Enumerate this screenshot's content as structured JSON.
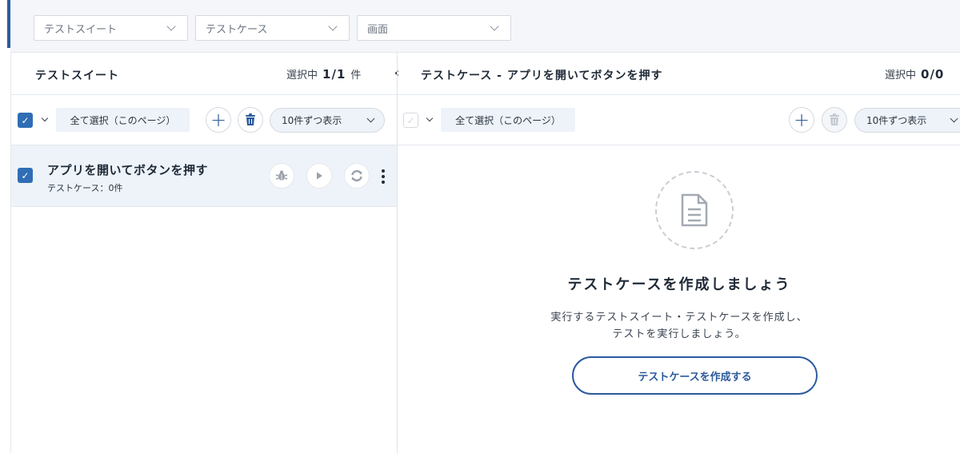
{
  "filters": [
    {
      "placeholder": "テストスイート"
    },
    {
      "placeholder": "テストケース"
    },
    {
      "placeholder": "画面"
    }
  ],
  "left_panel": {
    "title": "テストスイート",
    "selected_label": "選択中",
    "selected_value": "1/1",
    "selected_unit": "件",
    "select_all_label": "全て選択（このページ）",
    "page_size_label": "10件ずつ表示",
    "header_checkbox_checked": true,
    "suites": [
      {
        "name": "アプリを開いてボタンを押す",
        "subtitle": "テストケース：0件",
        "checked": true
      }
    ]
  },
  "right_panel": {
    "title": "テストケース - アプリを開いてボタンを押す",
    "selected_label": "選択中",
    "selected_value": "0/0",
    "select_all_label": "全て選択（このページ）",
    "page_size_label": "10件ずつ表示",
    "header_checkbox_checked": false,
    "empty_title": "テストケースを作成しましょう",
    "empty_desc_line1": "実行するテストスイート・テストケースを作成し、",
    "empty_desc_line2": "テストを実行しましょう。",
    "create_button_label": "テストケースを作成する"
  },
  "colors": {
    "accent": "#2c5a9c",
    "checkbox": "#2f6db5",
    "row_highlight": "#eef3f9"
  }
}
